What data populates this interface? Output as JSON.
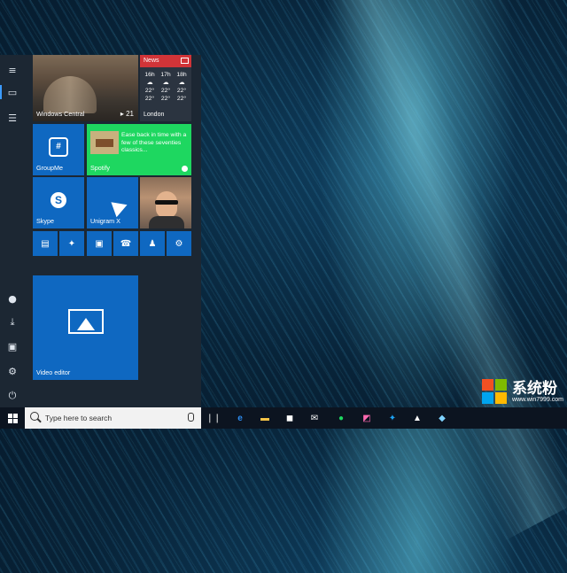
{
  "start_menu": {
    "rail": [
      "hamburger-icon",
      "tiles-icon",
      "all-apps-icon",
      "user-icon",
      "downloads-icon",
      "pictures-icon",
      "settings-icon",
      "power-icon"
    ],
    "tiles": {
      "windows_central": {
        "label": "Windows Central",
        "badge": "21"
      },
      "news": {
        "title": "News",
        "forecast": [
          {
            "day": "16h",
            "high": "22°",
            "low": "22°"
          },
          {
            "day": "17h",
            "high": "22°",
            "low": "22°"
          },
          {
            "day": "18h",
            "high": "22°",
            "low": "22°"
          }
        ],
        "city": "London"
      },
      "groupme": {
        "label": "GroupMe"
      },
      "spotify": {
        "label": "Spotify",
        "text": "Ease back in time with a few of these seventies classics..."
      },
      "skype": {
        "label": "Skype",
        "glyph": "S"
      },
      "unigram": {
        "label": "Unigram X"
      },
      "video_editor": {
        "label": "Video editor"
      }
    },
    "small_tiles": [
      {
        "name": "trello-icon",
        "glyph": "▤"
      },
      {
        "name": "twitter-icon",
        "glyph": "✦"
      },
      {
        "name": "remote-desktop-icon",
        "glyph": "▣"
      },
      {
        "name": "contact-icon",
        "glyph": "☎"
      },
      {
        "name": "people-icon",
        "glyph": "♟"
      },
      {
        "name": "settings-icon",
        "glyph": "⚙"
      }
    ]
  },
  "taskbar": {
    "search_placeholder": "Type here to search",
    "pinned": [
      {
        "name": "task-view-icon",
        "glyph": "❘❘",
        "color": "#ffffff"
      },
      {
        "name": "edge-icon",
        "glyph": "e",
        "color": "#2d8cf0"
      },
      {
        "name": "file-explorer-icon",
        "glyph": "▬",
        "color": "#f5c447"
      },
      {
        "name": "store-icon",
        "glyph": "◼",
        "color": "#ffffff"
      },
      {
        "name": "mail-icon",
        "glyph": "✉",
        "color": "#ffffff"
      },
      {
        "name": "spotify-icon",
        "glyph": "●",
        "color": "#1ed760"
      },
      {
        "name": "photos-icon",
        "glyph": "◩",
        "color": "#ff6ab0"
      },
      {
        "name": "twitter-icon",
        "glyph": "✦",
        "color": "#1da1f2"
      },
      {
        "name": "image-icon",
        "glyph": "▲",
        "color": "#ffffff"
      },
      {
        "name": "paint-icon",
        "glyph": "◆",
        "color": "#7fd3ff"
      }
    ]
  },
  "watermark": {
    "text": "系统粉",
    "url": "www.win7999.com",
    "colors": [
      "#f25022",
      "#7fba00",
      "#00a4ef",
      "#ffb900"
    ]
  }
}
